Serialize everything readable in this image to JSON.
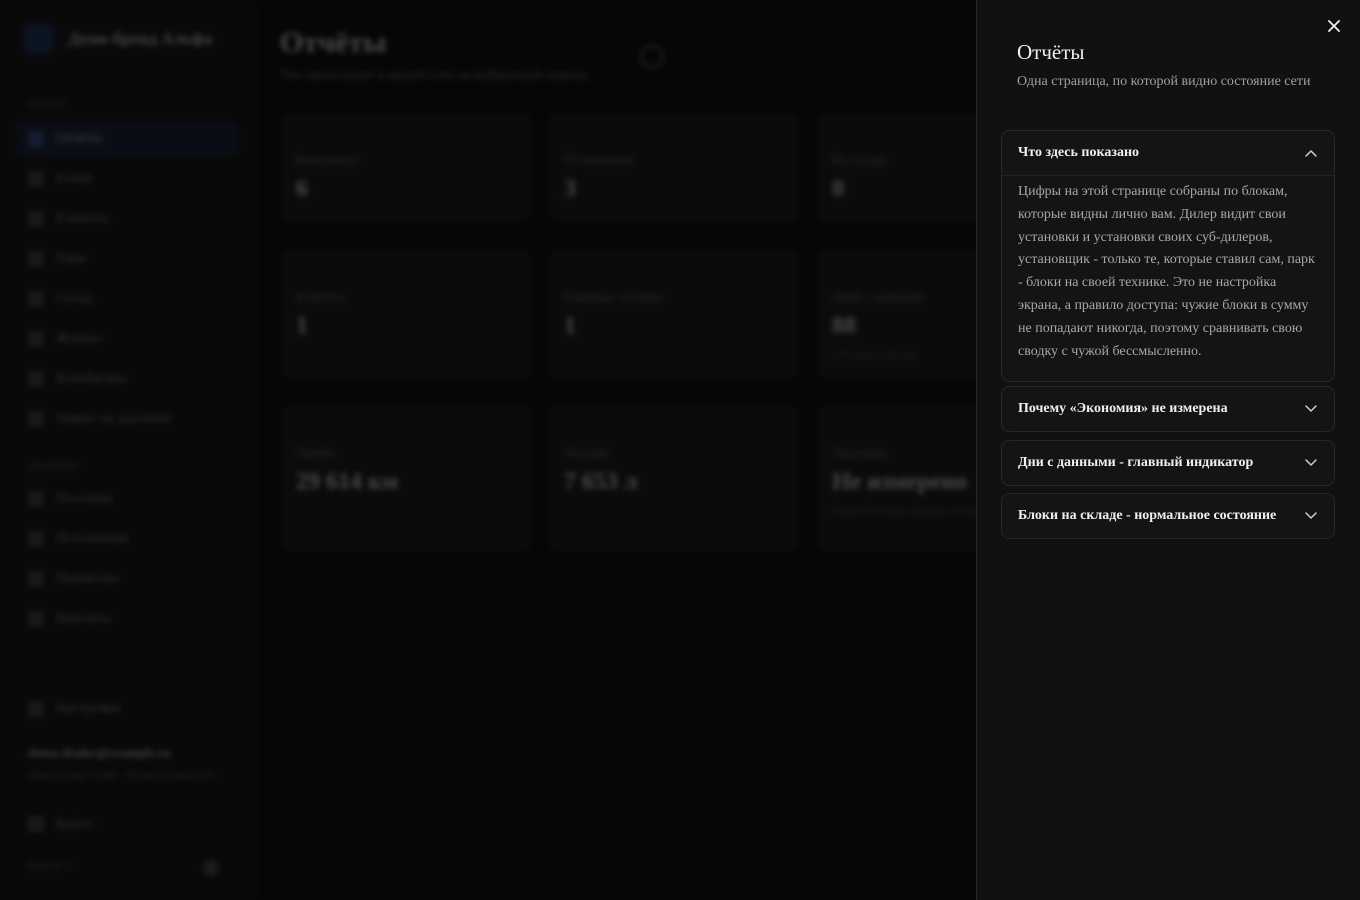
{
  "background": {
    "brand": {
      "name": "Демо-бренд Альфа"
    },
    "sidebar": {
      "section_reports": "ОБЗОР",
      "items_top": [
        {
          "label": "Отчёты",
          "active": true
        },
        {
          "label": "Блоки"
        },
        {
          "label": "Клиенты"
        },
        {
          "label": "Парк"
        },
        {
          "label": "Склад"
        },
        {
          "label": "Журнал"
        },
        {
          "label": "Калибровка"
        },
        {
          "label": "Заявки на удаление"
        }
      ],
      "section_dealers": "ДИЛЕРЫ",
      "items_bottom": [
        {
          "label": "Поставки"
        },
        {
          "label": "Исполнения"
        },
        {
          "label": "Перевозки"
        },
        {
          "label": "Выплаты"
        }
      ],
      "settings_label": "Настройки",
      "user_email": "demo.dealer@example.ru",
      "user_org": "Демо-дилер Альфа · Владелец аккаунта",
      "logout_label": "Выйти",
      "version": "Версия 2.1"
    },
    "main": {
      "title": "Отчёты",
      "subtitle": "Что происходит в вашей сети за выбранный период"
    },
    "cards": [
      {
        "label": "Комплекты",
        "value": "6",
        "note": ""
      },
      {
        "label": "Установлено",
        "value": "3",
        "note": ""
      },
      {
        "label": "На складе",
        "value": "0",
        "note": ""
      },
      {
        "label": "Клиенты",
        "value": "1",
        "note": ""
      },
      {
        "label": "Единицы техники",
        "value": "1",
        "note": ""
      },
      {
        "label": "Дней с данными",
        "value": "88",
        "note": "в 90 днях периода"
      },
      {
        "label": "Пробег",
        "value": "29 614 км",
        "note": ""
      },
      {
        "label": "Топливо",
        "value": "7 653 л",
        "note": ""
      },
      {
        "label": "Экономия",
        "value": "Не измерено",
        "note": "Нужен базовый замер до установки"
      }
    ]
  },
  "panel": {
    "title": "Отчёты",
    "subtitle": "Одна страница, по которой видно состояние сети",
    "close_icon": "close-icon",
    "accordion": [
      {
        "title": "Что здесь показано",
        "expanded": true,
        "body": "Цифры на этой странице собраны по блокам, которые видны лично вам. Дилер видит свои установки и установки своих суб-дилеров, установщик - только те, которые ставил сам, парк - блоки на своей технике. Это не настройка экрана, а правило доступа: чужие блоки в сумму не попадают никогда, поэтому сравнивать свою сводку с чужой бессмысленно."
      },
      {
        "title": "Почему «Экономия» не измерена",
        "expanded": false
      },
      {
        "title": "Дни с данными - главный индикатор",
        "expanded": false
      },
      {
        "title": "Блоки на складе - нормальное состояние",
        "expanded": false
      }
    ]
  }
}
